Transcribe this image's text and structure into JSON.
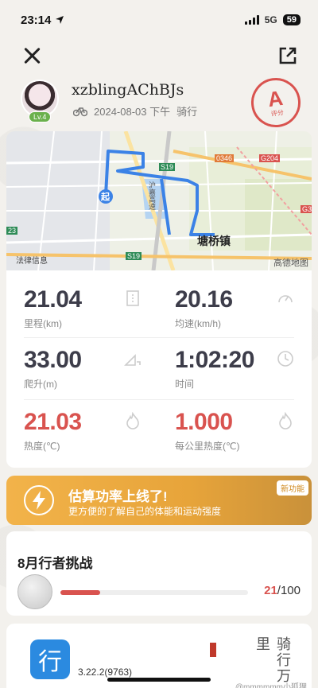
{
  "status_bar": {
    "time": "23:14",
    "network": "5G",
    "battery": "59"
  },
  "profile": {
    "username": "xzblingAChBJs",
    "level": "Lv.4",
    "datetime": "2024-08-03 下午",
    "activity": "骑行",
    "grade": "A",
    "grade_label": "评分"
  },
  "map": {
    "start_label": "起",
    "place_label": "塘桥镇",
    "road_s19_top": "S19",
    "road_s19_bottom": "S19",
    "road_0346": "0346",
    "road_g204": "G204",
    "road_g3": "G3",
    "road_23": "23",
    "expressway_label": "沪嘉高速",
    "bottom_left_label": "法律信息",
    "attribution": "高德地图"
  },
  "stats": [
    {
      "value": "21.04",
      "label": "里程(km)",
      "red": false
    },
    {
      "value": "20.16",
      "label": "均速(km/h)",
      "red": false
    },
    {
      "value": "33.00",
      "label": "爬升(m)",
      "red": false
    },
    {
      "value": "1:02:20",
      "label": "时间",
      "red": false
    },
    {
      "value": "21.03",
      "label": "热度(℃)",
      "red": true
    },
    {
      "value": "1.000",
      "label": "每公里热度(℃)",
      "red": true
    }
  ],
  "banner": {
    "title": "估算功率上线了!",
    "subtitle": "更方便的了解自己的体能和运动强度",
    "tag": "新功能"
  },
  "challenge": {
    "title": "8月行者挑战",
    "current": "21",
    "total": "/100",
    "progress_fraction": 0.21
  },
  "footer": {
    "app_glyph": "行",
    "version": "3.22.2(9763)",
    "calligraphy": "骑行万里",
    "watermark": "@mmmmmm小狐狸"
  },
  "colors": {
    "accent_red": "#d9534f",
    "route_blue": "#3b82e6",
    "banner_orange": "#f2b34a",
    "app_blue": "#2b8ae0"
  }
}
